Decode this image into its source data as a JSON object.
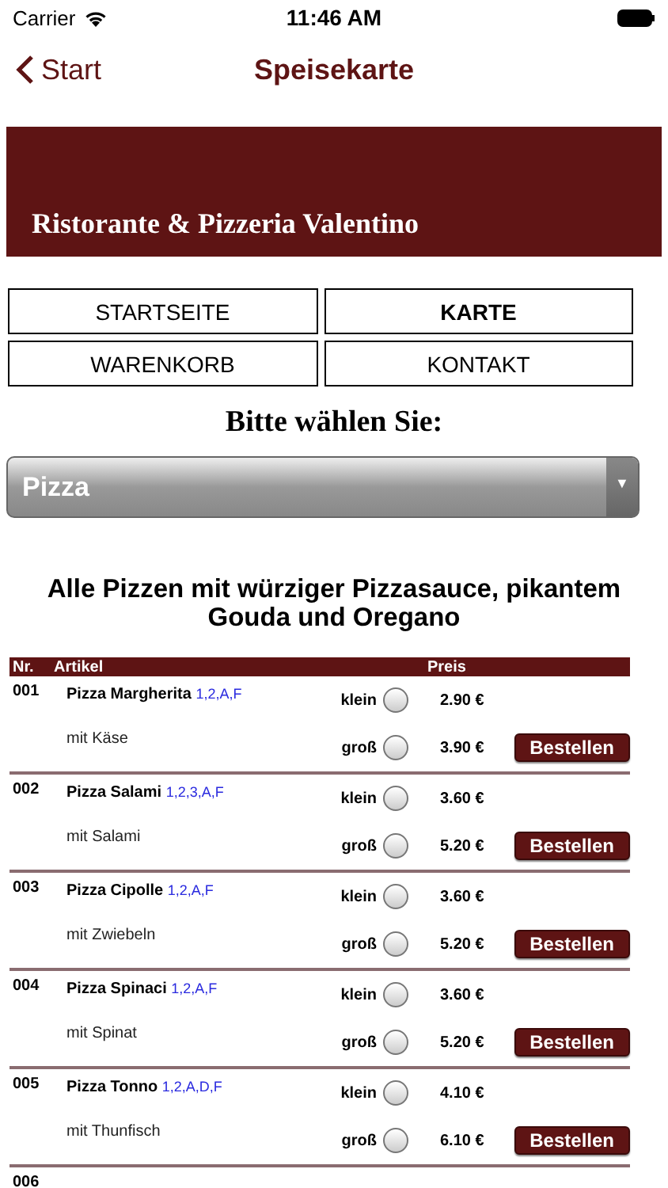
{
  "status_bar": {
    "carrier": "Carrier",
    "time": "11:46 AM"
  },
  "nav_bar": {
    "back": "Start",
    "title": "Speisekarte"
  },
  "banner": {
    "title": "Ristorante & Pizzeria Valentino"
  },
  "menu": [
    {
      "label": "STARTSEITE",
      "selected": false
    },
    {
      "label": "KARTE",
      "selected": true
    },
    {
      "label": "WARENKORB",
      "selected": false
    },
    {
      "label": "KONTAKT",
      "selected": false
    }
  ],
  "prompt": "Bitte wählen Sie:",
  "category_select": {
    "value": "Pizza",
    "arrow": "▼"
  },
  "section_title": "Alle Pizzen mit würziger Pizzasauce, pikantem Gouda und Oregano",
  "table": {
    "columns": [
      "Nr.",
      "Artikel",
      "Preis"
    ],
    "rows": [
      {
        "nr": "001",
        "name": "Pizza Margherita",
        "allergens": "1,2,A,F",
        "description": "mit Käse",
        "sizes": [
          {
            "label": "klein",
            "price": "2.90 €",
            "selected": false
          },
          {
            "label": "groß",
            "price": "3.90 €",
            "selected": false
          }
        ],
        "button": "Bestellen"
      },
      {
        "nr": "002",
        "name": "Pizza Salami",
        "allergens": "1,2,3,A,F",
        "description": "mit Salami",
        "sizes": [
          {
            "label": "klein",
            "price": "3.60 €",
            "selected": false
          },
          {
            "label": "groß",
            "price": "5.20 €",
            "selected": false
          }
        ],
        "button": "Bestellen"
      },
      {
        "nr": "003",
        "name": "Pizza Cipolle",
        "allergens": "1,2,A,F",
        "description": "mit Zwiebeln",
        "sizes": [
          {
            "label": "klein",
            "price": "3.60 €",
            "selected": false
          },
          {
            "label": "groß",
            "price": "5.20 €",
            "selected": false
          }
        ],
        "button": "Bestellen"
      },
      {
        "nr": "004",
        "name": "Pizza Spinaci",
        "allergens": "1,2,A,F",
        "description": "mit Spinat",
        "sizes": [
          {
            "label": "klein",
            "price": "3.60 €",
            "selected": false
          },
          {
            "label": "groß",
            "price": "5.20 €",
            "selected": false
          }
        ],
        "button": "Bestellen"
      },
      {
        "nr": "005",
        "name": "Pizza Tonno",
        "allergens": "1,2,A,D,F",
        "description": "mit Thunfisch",
        "sizes": [
          {
            "label": "klein",
            "price": "4.10 €",
            "selected": false
          },
          {
            "label": "groß",
            "price": "6.10 €",
            "selected": false
          }
        ],
        "button": "Bestellen"
      },
      {
        "nr": "006"
      }
    ]
  }
}
